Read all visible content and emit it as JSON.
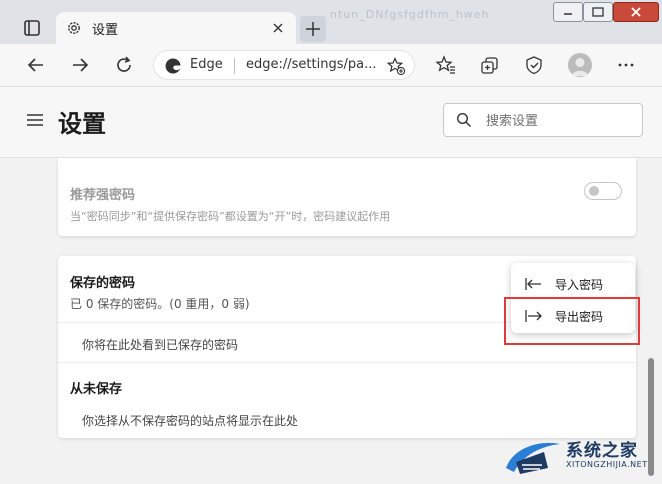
{
  "browser": {
    "tab_title": "设置",
    "address_label": "Edge",
    "address_url": "edge://settings/pa...",
    "title_decor": "ntun_DNfgsfgdfhm_hweh"
  },
  "header": {
    "title": "设置",
    "search_placeholder": "搜索设置"
  },
  "strong_password": {
    "title": "推荐强密码",
    "description": "当“密码同步”和“提供保存密码”都设置为“开”时，密码建议起作用",
    "enabled": false
  },
  "saved_passwords": {
    "title": "保存的密码",
    "summary": "已 0 保存的密码。(0 重用，0 弱)",
    "empty_message": "你将在此处看到已保存的密码"
  },
  "never_saved": {
    "title": "从未保存",
    "empty_message": "你选择从不保存密码的站点将显示在此处"
  },
  "menu": {
    "import_label": "导入密码",
    "export_label": "导出密码",
    "highlight_color": "#e03b3b"
  },
  "watermark": {
    "title": "系统之家",
    "subtitle": "XITONGZHIJIA.NET"
  }
}
